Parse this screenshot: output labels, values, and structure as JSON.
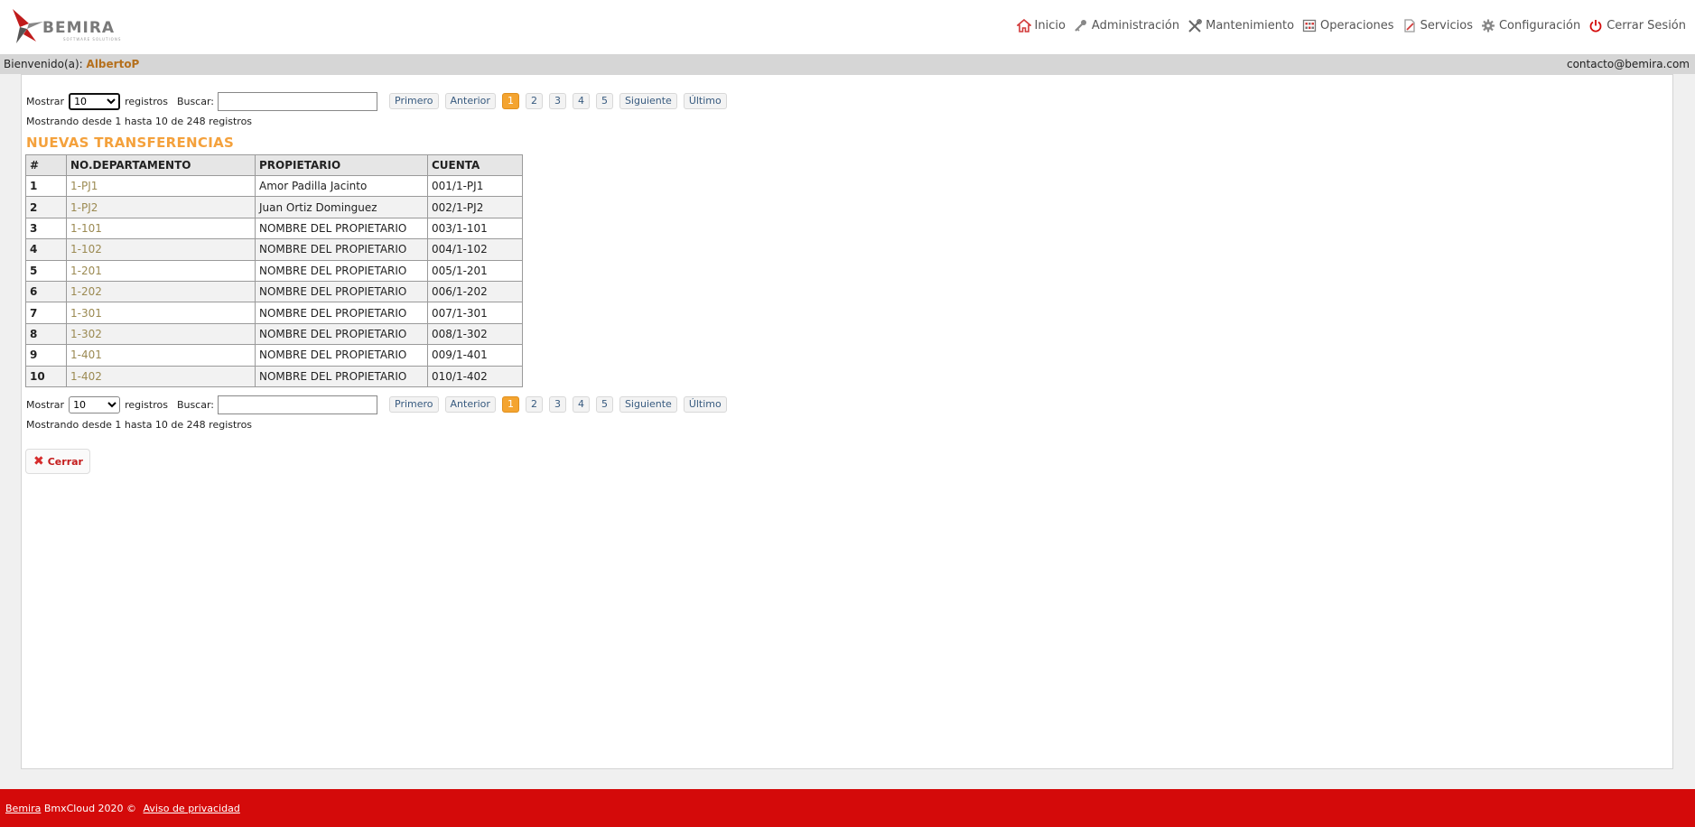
{
  "brand": {
    "name": "BEMIRA",
    "tagline": "SOFTWARE SOLUTIONS"
  },
  "nav": [
    {
      "label": "Inicio",
      "icon": "home-icon"
    },
    {
      "label": "Administración",
      "icon": "key-icon"
    },
    {
      "label": "Mantenimiento",
      "icon": "tools-icon"
    },
    {
      "label": "Operaciones",
      "icon": "calculator-icon"
    },
    {
      "label": "Servicios",
      "icon": "document-icon"
    },
    {
      "label": "Configuración",
      "icon": "gear-icon"
    },
    {
      "label": "Cerrar Sesión",
      "icon": "power-icon"
    }
  ],
  "welcome": {
    "prefix": "Bienvenido(a):",
    "user": "AlbertoP",
    "email": "contacto@bemira.com"
  },
  "controls": {
    "show_label": "Mostrar",
    "show_value": "10",
    "records_label": "registros",
    "search_label": "Buscar:",
    "search_value": "",
    "pager": {
      "first": "Primero",
      "prev": "Anterior",
      "pages": [
        "1",
        "2",
        "3",
        "4",
        "5"
      ],
      "active": "1",
      "next": "Siguiente",
      "last": "Último"
    },
    "info": "Mostrando desde 1 hasta 10 de 248 registros"
  },
  "section_title": "NUEVAS TRANSFERENCIAS",
  "table": {
    "headers": [
      "#",
      "NO.DEPARTAMENTO",
      "PROPIETARIO",
      "CUENTA"
    ],
    "rows": [
      [
        "1",
        "1-PJ1",
        "Amor Padilla Jacinto",
        "001/1-PJ1"
      ],
      [
        "2",
        "1-PJ2",
        "Juan Ortiz Dominguez",
        "002/1-PJ2"
      ],
      [
        "3",
        "1-101",
        "NOMBRE DEL PROPIETARIO",
        "003/1-101"
      ],
      [
        "4",
        "1-102",
        "NOMBRE DEL PROPIETARIO",
        "004/1-102"
      ],
      [
        "5",
        "1-201",
        "NOMBRE DEL PROPIETARIO",
        "005/1-201"
      ],
      [
        "6",
        "1-202",
        "NOMBRE DEL PROPIETARIO",
        "006/1-202"
      ],
      [
        "7",
        "1-301",
        "NOMBRE DEL PROPIETARIO",
        "007/1-301"
      ],
      [
        "8",
        "1-302",
        "NOMBRE DEL PROPIETARIO",
        "008/1-302"
      ],
      [
        "9",
        "1-401",
        "NOMBRE DEL PROPIETARIO",
        "009/1-401"
      ],
      [
        "10",
        "1-402",
        "NOMBRE DEL PROPIETARIO",
        "010/1-402"
      ]
    ]
  },
  "close_button": {
    "label": "Cerrar"
  },
  "footer": {
    "brand_link": "Bemira",
    "text": "BmxCloud 2020 ©",
    "privacy_link": "Aviso de privacidad"
  },
  "colors": {
    "accent_orange": "#f4a13c",
    "footer_red": "#d40a0a",
    "welcome_bar": "#d6d6d6"
  }
}
